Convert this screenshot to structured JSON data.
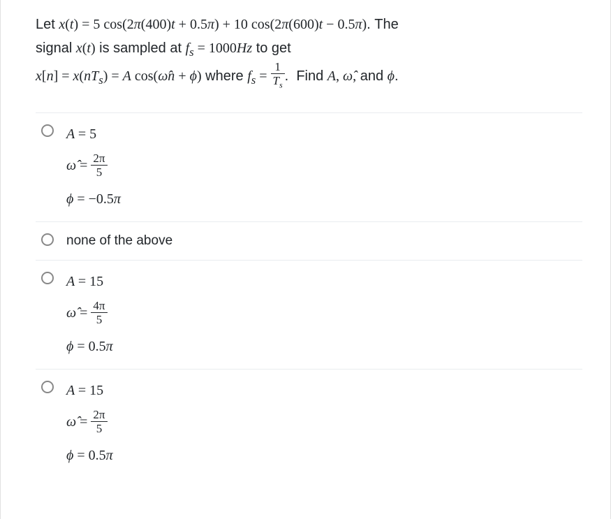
{
  "question": {
    "part1_pre": "Let ",
    "part1_expr": "x(t) = 5 cos(2π(400)t + 0.5π) + 10 cos(2π(600)t − 0.5π)",
    "part1_post": ". The",
    "part2_pre": "signal ",
    "part2_sig": "x(t)",
    "part2_mid": " is sampled at ",
    "part2_fs": "f",
    "part2_s": "s",
    "part2_eq": " = 1000Hz",
    "part2_post": " to get",
    "part3_expr": "x[n] = x(nT",
    "part3_s": "s",
    "part3_expr2": ") = A cos(ω̂n + ϕ)",
    "part3_where": " where ",
    "part3_fs": "f",
    "part3_eq": " = ",
    "part3_frac_num": "1",
    "part3_frac_den": "T",
    "part3_frac_den_s": "s",
    "part3_post": ". Find ",
    "part3_find": "A, ω̂,",
    "part3_and": " and ",
    "part3_phi": "ϕ",
    "part3_end": "."
  },
  "options": [
    {
      "line1": "A = 5",
      "omega_num": "2π",
      "omega_den": "5",
      "phi": "ϕ = −0.5π"
    },
    {
      "text": "none of the above"
    },
    {
      "line1": "A = 15",
      "omega_num": "4π",
      "omega_den": "5",
      "phi": "ϕ = 0.5π"
    },
    {
      "line1": "A = 15",
      "omega_num": "2π",
      "omega_den": "5",
      "phi": "ϕ = 0.5π"
    }
  ]
}
